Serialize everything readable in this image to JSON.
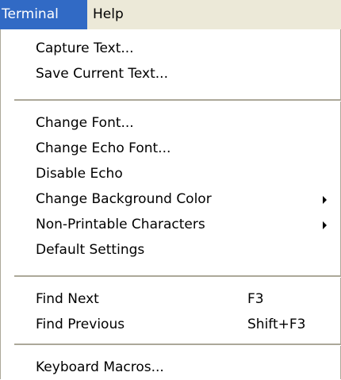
{
  "menubar": {
    "items": [
      {
        "label": "Terminal"
      },
      {
        "label": "Help"
      }
    ]
  },
  "menu": {
    "groups": [
      {
        "items": [
          {
            "label": "Capture Text..."
          },
          {
            "label": "Save Current Text..."
          }
        ]
      },
      {
        "items": [
          {
            "label": "Change Font..."
          },
          {
            "label": "Change Echo Font..."
          },
          {
            "label": "Disable Echo"
          },
          {
            "label": "Change Background Color"
          },
          {
            "label": "Non-Printable Characters"
          },
          {
            "label": "Default Settings"
          }
        ]
      },
      {
        "items": [
          {
            "label": "Find Next",
            "shortcut": "F3"
          },
          {
            "label": "Find Previous",
            "shortcut": "Shift+F3"
          }
        ]
      },
      {
        "items": [
          {
            "label": "Keyboard Macros..."
          }
        ]
      }
    ]
  },
  "colors": {
    "menubar_bg": "#ece9d8",
    "highlight": "#316ac5",
    "separator": "#aca899"
  },
  "icons": [
    "submenu-arrow-icon"
  ]
}
